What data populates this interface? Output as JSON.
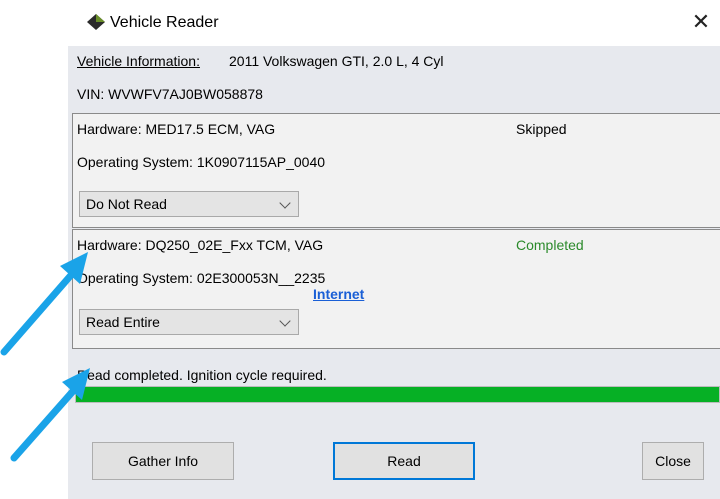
{
  "window": {
    "title": "Vehicle Reader",
    "close_glyph": "✕"
  },
  "vehicle": {
    "info_label": "Vehicle Information:",
    "info_value": "2011 Volkswagen GTI, 2.0 L, 4 Cyl",
    "vin": "VIN: WVWFV7AJ0BW058878"
  },
  "modules": [
    {
      "hardware": "Hardware: MED17.5 ECM, VAG",
      "os": "Operating System: 1K0907115AP_0040",
      "status": "Skipped",
      "read_option": "Do Not Read"
    },
    {
      "hardware": "Hardware: DQ250_02E_Fxx TCM, VAG",
      "os": "Operating System: 02E300053N__2235",
      "status": "Completed",
      "link": "Internet",
      "read_option": "Read Entire"
    }
  ],
  "progress": {
    "message": "Read completed. Ignition cycle required.",
    "percent": 100
  },
  "buttons": {
    "gather": "Gather Info",
    "read": "Read",
    "close": "Close"
  },
  "colors": {
    "arrow": "#1aa3e8",
    "progress": "#06b025",
    "completed": "#2b8a2b"
  },
  "icons": [
    "app-diamond-icon",
    "close-icon",
    "chevron-down-icon",
    "pointer-arrow-icon"
  ]
}
